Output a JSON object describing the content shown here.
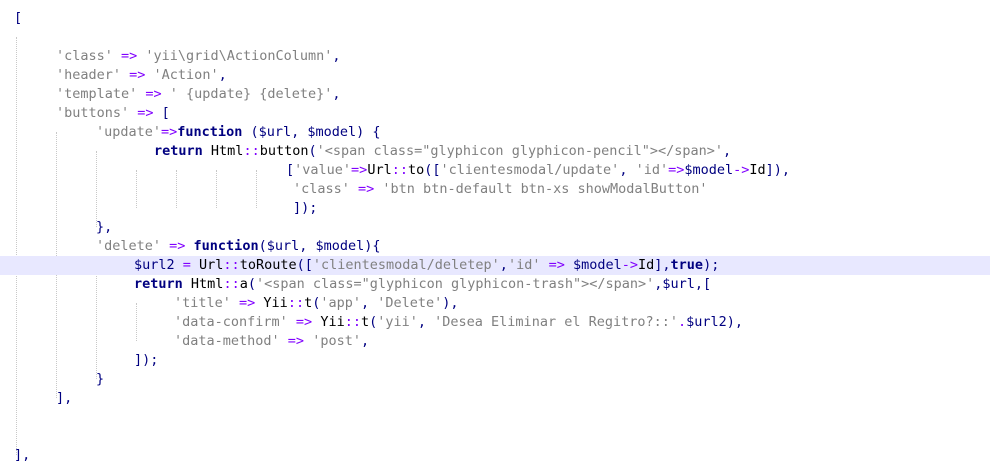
{
  "editor": {
    "colors": {
      "string": "#808080",
      "operator": "#8000ff",
      "keyword": "#000080",
      "current_line": "#e8e8ff",
      "background": "#ffffff"
    },
    "lines": [
      {
        "tokens": [
          {
            "t": "[",
            "c": "punc"
          }
        ]
      },
      {
        "tokens": []
      },
      {
        "tokens": [
          {
            "t": "'class'",
            "c": "str"
          },
          {
            "t": " => ",
            "c": "op"
          },
          {
            "t": "'yii\\grid\\ActionColumn'",
            "c": "str"
          },
          {
            "t": ",",
            "c": "punc"
          }
        ]
      },
      {
        "tokens": [
          {
            "t": "'header'",
            "c": "str"
          },
          {
            "t": " => ",
            "c": "op"
          },
          {
            "t": "'Action'",
            "c": "str"
          },
          {
            "t": ",",
            "c": "punc"
          }
        ]
      },
      {
        "tokens": [
          {
            "t": "'template'",
            "c": "str"
          },
          {
            "t": " => ",
            "c": "op"
          },
          {
            "t": "' {update} {delete}'",
            "c": "str"
          },
          {
            "t": ",",
            "c": "punc"
          }
        ]
      },
      {
        "tokens": [
          {
            "t": "'buttons'",
            "c": "str"
          },
          {
            "t": " => ",
            "c": "op"
          },
          {
            "t": "[",
            "c": "punc"
          }
        ]
      },
      {
        "tokens": [
          {
            "t": "'update'",
            "c": "str"
          },
          {
            "t": "=>",
            "c": "op"
          },
          {
            "t": "function",
            "c": "kw"
          },
          {
            "t": " (",
            "c": "punc"
          },
          {
            "t": "$url",
            "c": "var"
          },
          {
            "t": ", ",
            "c": "punc"
          },
          {
            "t": "$model",
            "c": "var"
          },
          {
            "t": ") {",
            "c": "punc"
          }
        ]
      },
      {
        "tokens": [
          {
            "t": "return",
            "c": "kw"
          },
          {
            "t": " ",
            "c": "id"
          },
          {
            "t": "Html",
            "c": "fn"
          },
          {
            "t": "::",
            "c": "op"
          },
          {
            "t": "button",
            "c": "fn"
          },
          {
            "t": "(",
            "c": "punc"
          },
          {
            "t": "'<span class=\"glyphicon glyphicon-pencil\"></span>'",
            "c": "str"
          },
          {
            "t": ",",
            "c": "punc"
          }
        ]
      },
      {
        "tokens": [
          {
            "t": "[",
            "c": "punc"
          },
          {
            "t": "'value'",
            "c": "str"
          },
          {
            "t": "=>",
            "c": "op"
          },
          {
            "t": "Url",
            "c": "fn"
          },
          {
            "t": "::",
            "c": "op"
          },
          {
            "t": "to",
            "c": "fn"
          },
          {
            "t": "([",
            "c": "punc"
          },
          {
            "t": "'clientesmodal/update'",
            "c": "str"
          },
          {
            "t": ", ",
            "c": "punc"
          },
          {
            "t": "'id'",
            "c": "str"
          },
          {
            "t": "=>",
            "c": "op"
          },
          {
            "t": "$model",
            "c": "var"
          },
          {
            "t": "->",
            "c": "op"
          },
          {
            "t": "Id",
            "c": "fn"
          },
          {
            "t": "]),",
            "c": "punc"
          }
        ]
      },
      {
        "tokens": [
          {
            "t": "'class'",
            "c": "str"
          },
          {
            "t": " => ",
            "c": "op"
          },
          {
            "t": "'btn btn-default btn-xs showModalButton'",
            "c": "str"
          }
        ]
      },
      {
        "tokens": [
          {
            "t": "]);",
            "c": "punc"
          }
        ]
      },
      {
        "tokens": [
          {
            "t": "},",
            "c": "punc"
          }
        ]
      },
      {
        "tokens": [
          {
            "t": "'delete'",
            "c": "str"
          },
          {
            "t": " => ",
            "c": "op"
          },
          {
            "t": "function",
            "c": "kw"
          },
          {
            "t": "(",
            "c": "punc"
          },
          {
            "t": "$url",
            "c": "var"
          },
          {
            "t": ", ",
            "c": "punc"
          },
          {
            "t": "$model",
            "c": "var"
          },
          {
            "t": "){",
            "c": "punc"
          }
        ]
      },
      {
        "tokens": [
          {
            "t": "$url2",
            "c": "var"
          },
          {
            "t": " = ",
            "c": "op"
          },
          {
            "t": "Url",
            "c": "fn"
          },
          {
            "t": "::",
            "c": "op"
          },
          {
            "t": "toRoute",
            "c": "fn"
          },
          {
            "t": "([",
            "c": "punc"
          },
          {
            "t": "'clientesmodal/deletep'",
            "c": "str"
          },
          {
            "t": ",",
            "c": "punc"
          },
          {
            "t": "'id'",
            "c": "str"
          },
          {
            "t": " => ",
            "c": "op"
          },
          {
            "t": "$model",
            "c": "var"
          },
          {
            "t": "->",
            "c": "op"
          },
          {
            "t": "Id",
            "c": "fn"
          },
          {
            "t": "],",
            "c": "punc"
          },
          {
            "t": "true",
            "c": "kw"
          },
          {
            "t": ");",
            "c": "punc"
          }
        ]
      },
      {
        "tokens": [
          {
            "t": "return",
            "c": "kw"
          },
          {
            "t": " ",
            "c": "id"
          },
          {
            "t": "Html",
            "c": "fn"
          },
          {
            "t": "::",
            "c": "op"
          },
          {
            "t": "a",
            "c": "fn"
          },
          {
            "t": "(",
            "c": "punc"
          },
          {
            "t": "'<span class=\"glyphicon glyphicon-trash\"></span>'",
            "c": "str"
          },
          {
            "t": ",",
            "c": "punc"
          },
          {
            "t": "$url",
            "c": "var"
          },
          {
            "t": ",[",
            "c": "punc"
          }
        ]
      },
      {
        "tokens": [
          {
            "t": "'title'",
            "c": "str"
          },
          {
            "t": " => ",
            "c": "op"
          },
          {
            "t": "Yii",
            "c": "fn"
          },
          {
            "t": "::",
            "c": "op"
          },
          {
            "t": "t",
            "c": "fn"
          },
          {
            "t": "(",
            "c": "punc"
          },
          {
            "t": "'app'",
            "c": "str"
          },
          {
            "t": ", ",
            "c": "punc"
          },
          {
            "t": "'Delete'",
            "c": "str"
          },
          {
            "t": "),",
            "c": "punc"
          }
        ]
      },
      {
        "tokens": [
          {
            "t": "'data-confirm'",
            "c": "str"
          },
          {
            "t": " => ",
            "c": "op"
          },
          {
            "t": "Yii",
            "c": "fn"
          },
          {
            "t": "::",
            "c": "op"
          },
          {
            "t": "t",
            "c": "fn"
          },
          {
            "t": "(",
            "c": "punc"
          },
          {
            "t": "'yii'",
            "c": "str"
          },
          {
            "t": ", ",
            "c": "punc"
          },
          {
            "t": "'Desea Eliminar el Regitro?::'",
            "c": "str"
          },
          {
            "t": ".",
            "c": "op"
          },
          {
            "t": "$url2",
            "c": "var"
          },
          {
            "t": "),",
            "c": "punc"
          }
        ]
      },
      {
        "tokens": [
          {
            "t": "'data-method'",
            "c": "str"
          },
          {
            "t": " => ",
            "c": "op"
          },
          {
            "t": "'post'",
            "c": "str"
          },
          {
            "t": ",",
            "c": "punc"
          }
        ]
      },
      {
        "tokens": [
          {
            "t": "]);",
            "c": "punc"
          }
        ]
      },
      {
        "tokens": [
          {
            "t": "}",
            "c": "punc"
          }
        ]
      },
      {
        "tokens": [
          {
            "t": "],",
            "c": "punc"
          }
        ]
      },
      {
        "tokens": []
      },
      {
        "tokens": []
      },
      {
        "tokens": [
          {
            "t": "],",
            "c": "punc"
          }
        ]
      }
    ]
  }
}
